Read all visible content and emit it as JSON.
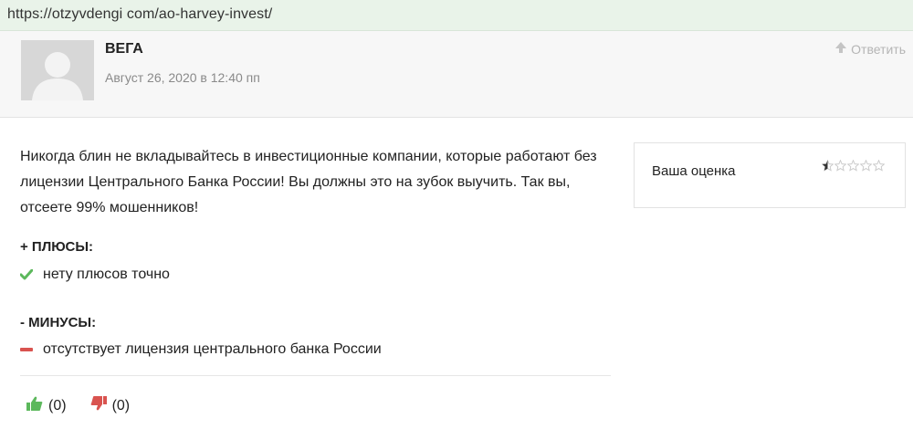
{
  "browser": {
    "url": "https://otzyvdengi com/ao-harvey-invest/"
  },
  "comment": {
    "author": "ВЕГА",
    "date": "Август 26, 2020 в 12:40 пп",
    "reply_label": "Ответить",
    "text": "Никогда блин не вкладывайтесь в инвестиционные компании, которые работают без лицензии Центрального Банка России! Вы должны это на зубок выучить. Так вы, отсеете 99% мошенников!",
    "pros_title": "+ ПЛЮСЫ:",
    "pros": [
      "нету плюсов точно"
    ],
    "cons_title": "- МИНУСЫ:",
    "cons": [
      "отсутствует лицензия центрального банка России"
    ],
    "likes": "(0)",
    "dislikes": "(0)"
  },
  "rating": {
    "label": "Ваша оценка",
    "value": 0.5,
    "max": 5
  },
  "colors": {
    "like": "#5cb85c",
    "dislike": "#d9534f",
    "star": "#c9c9c9",
    "star_fill": "#333333"
  },
  "icons": {
    "reply": "up-arrow-icon",
    "pro": "checkmark-icon",
    "con": "minus-icon",
    "like": "thumbs-up-icon",
    "dislike": "thumbs-down-icon"
  }
}
